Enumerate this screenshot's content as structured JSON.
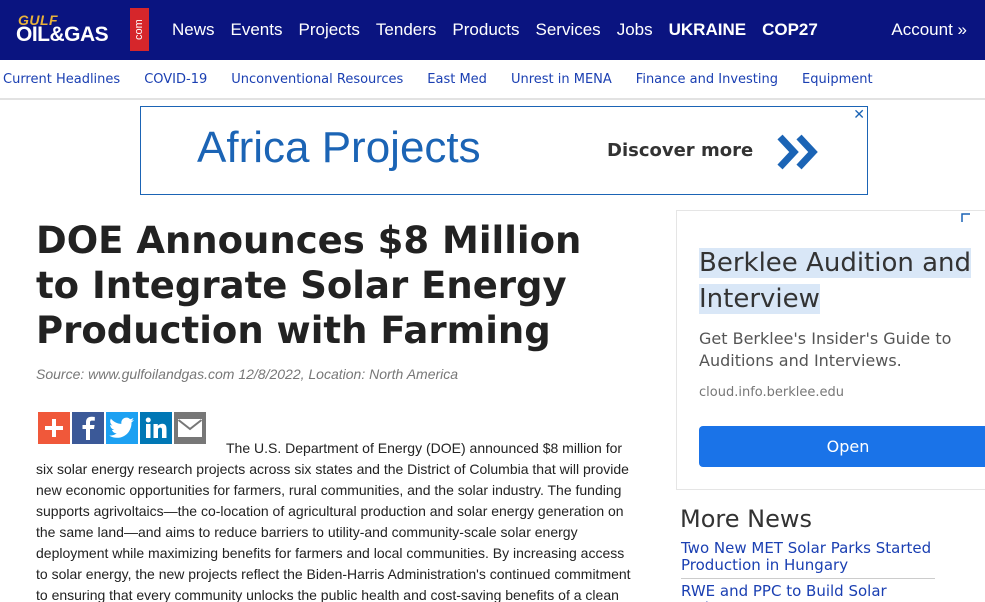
{
  "logo": {
    "top": "GULF",
    "main": "OIL&GAS",
    "suffix": "com"
  },
  "nav": {
    "items": [
      "News",
      "Events",
      "Projects",
      "Tenders",
      "Products",
      "Services",
      "Jobs"
    ],
    "bold_items": [
      "UKRAINE",
      "COP27"
    ],
    "account": "Account »"
  },
  "subnav": {
    "items": [
      "Current Headlines",
      "COVID-19",
      "Unconventional Resources",
      "East Med",
      "Unrest in MENA",
      "Finance and Investing",
      "Equipment"
    ]
  },
  "banner": {
    "title": "Africa Projects",
    "cta": "Discover more",
    "close": "✕"
  },
  "article": {
    "headline": "DOE Announces $8 Million to Integrate Solar Energy Production with Farming",
    "source": "Source: www.gulfoilandgas.com 12/8/2022, Location: North America",
    "body": "The U.S. Department of Energy (DOE) announced $8 million for six solar energy research projects across six states and the District of Columbia that will provide new economic opportunities for farmers, rural communities, and the solar industry. The funding supports agrivoltaics—the co-location of agricultural production and solar energy generation on the same land—and aims to reduce barriers to utility-and community-scale solar energy deployment while maximizing benefits for farmers and local communities. By increasing access to solar energy, the new projects reflect the Biden-Harris Administration's continued commitment to ensuring that every community unlocks the public health and cost-saving benefits of a clean"
  },
  "share": {
    "buttons": [
      {
        "icon": "plus-icon",
        "color": "#f0583a"
      },
      {
        "icon": "facebook-icon",
        "color": "#3b5998"
      },
      {
        "icon": "twitter-icon",
        "color": "#1da1f2"
      },
      {
        "icon": "linkedin-icon",
        "color": "#0077b5"
      },
      {
        "icon": "email-icon",
        "color": "#777777"
      }
    ]
  },
  "side_ad": {
    "title_line1": "Berklee Audition and",
    "title_line2": "Interview",
    "description": "Get Berklee's Insider's Guide to Auditions and Interviews.",
    "url": "cloud.info.berklee.edu",
    "button": "Open"
  },
  "more_news": {
    "title": "More News",
    "items": [
      "Two New MET Solar Parks Started Production in Hungary",
      "RWE and PPC to Build Solar Projects"
    ]
  },
  "colors": {
    "nav_bg": "#0a1480",
    "link": "#1a3fb2",
    "banner_accent": "#1b64b5",
    "ad_button": "#1a73e8"
  }
}
